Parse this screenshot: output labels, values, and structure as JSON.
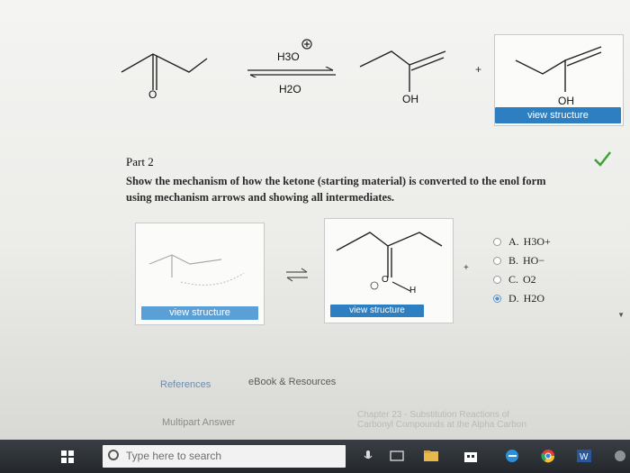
{
  "scheme": {
    "reactant_oxygen": "O",
    "reagent_top": "H3O",
    "reagent_top_charge": "+",
    "reagent_bottom": "H2O",
    "product1_label": "OH",
    "plus": "+",
    "product2_label": "OH",
    "view_structure_label": "view structure"
  },
  "part": {
    "title": "Part 2",
    "instruction_line1": "Show the mechanism of how the ketone (starting material) is converted to the enol form",
    "instruction_line2": "using mechanism arrows and showing all intermediates."
  },
  "mechanism": {
    "left_button": "view structure",
    "right_button": "view structure",
    "h_label": "H",
    "o_label": "O",
    "plus": "+",
    "charge_symbol": "+"
  },
  "options": [
    {
      "letter": "A.",
      "text": "H3O+",
      "selected": false
    },
    {
      "letter": "B.",
      "text": "HO−",
      "selected": false
    },
    {
      "letter": "C.",
      "text": "O2",
      "selected": false
    },
    {
      "letter": "D.",
      "text": "H2O",
      "selected": true
    }
  ],
  "links": {
    "references": "References",
    "ebook": "eBook & Resources",
    "multipart": "Multipart Answer",
    "chapter_line1": "Chapter 23 - Substitution Reactions of",
    "chapter_line2": "Carbonyl Compounds at the Alpha Carbon"
  },
  "taskbar": {
    "search_placeholder": "Type here to search"
  },
  "colors": {
    "accent_blue": "#2d7fc1",
    "check_green": "#3aa535",
    "taskbar": "#2a2e33"
  }
}
